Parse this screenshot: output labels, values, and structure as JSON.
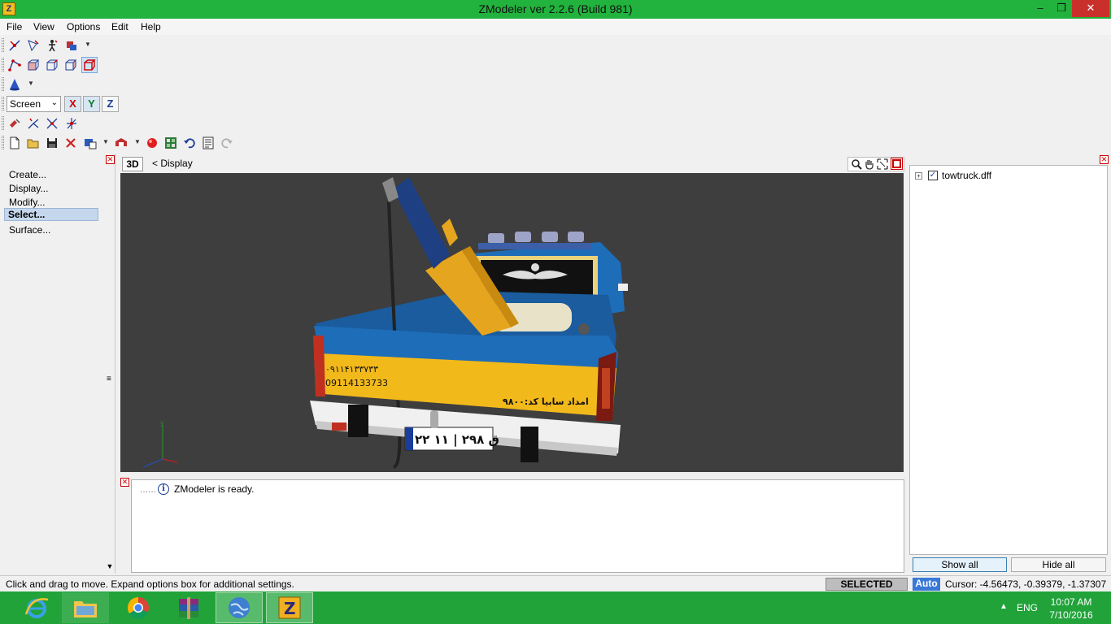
{
  "window": {
    "title": "ZModeler ver 2.2.6 (Build 981)",
    "app_icon_letter": "Z",
    "minimize": "–",
    "maximize": "❐",
    "close": "✕"
  },
  "menu": {
    "file": "File",
    "view": "View",
    "options": "Options",
    "edit": "Edit",
    "help": "Help"
  },
  "toolbar": {
    "coord_system": "Screen",
    "axis_x": "X",
    "axis_y": "Y",
    "axis_z": "Z"
  },
  "left_panel": {
    "items": [
      "Create...",
      "Display...",
      "Modify...",
      "Select...",
      "Surface..."
    ],
    "selected": "Select..."
  },
  "viewport": {
    "mode_button": "3D",
    "breadcrumb": "<   Display",
    "plate_text": "۲۲ ق ۲۹۸ | ۱۱",
    "phone_fa": "۰۹۱۱۴۱۳۳۷۳۳",
    "phone_en": "09114133733",
    "side_text": "امداد سابیا   کد:۹۸۰۰"
  },
  "log": {
    "dots": "......",
    "message": "ZModeler is ready."
  },
  "right_panel": {
    "tree_root": "towtruck.dff",
    "show_all": "Show all",
    "hide_all": "Hide all"
  },
  "status": {
    "hint": "Click and drag to move. Expand options box for additional settings.",
    "mode": "SELECTED MODE",
    "auto": "Auto",
    "cursor": "Cursor: -4.56473, -0.39379, -1.37307"
  },
  "taskbar": {
    "lang": "ENG",
    "time": "10:07 AM",
    "date": "7/10/2016"
  },
  "colors": {
    "titlebar": "#21b33d",
    "taskbar": "#21a33a",
    "viewport_bg": "#3e3e3e",
    "truck_blue": "#1e6db8",
    "truck_yellow": "#f2b91b",
    "crane_orange": "#e6a51e"
  }
}
